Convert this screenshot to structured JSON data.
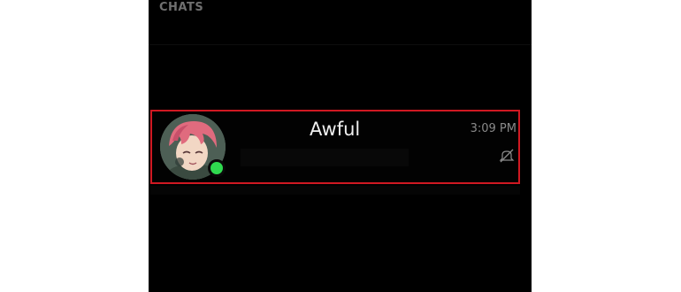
{
  "section": {
    "header": "CHATS"
  },
  "chat": {
    "name": "Awful",
    "time": "3:09 PM",
    "online": true,
    "muted": true,
    "avatar_icon": "anime-avatar-icon",
    "online_icon": "online-status-icon",
    "mute_icon": "muted-bell-icon"
  },
  "colors": {
    "background": "#000000",
    "highlight_border": "#d01822",
    "online": "#2fd94f",
    "name_text": "#f0f0f0",
    "secondary_text": "#8a8a8a"
  }
}
